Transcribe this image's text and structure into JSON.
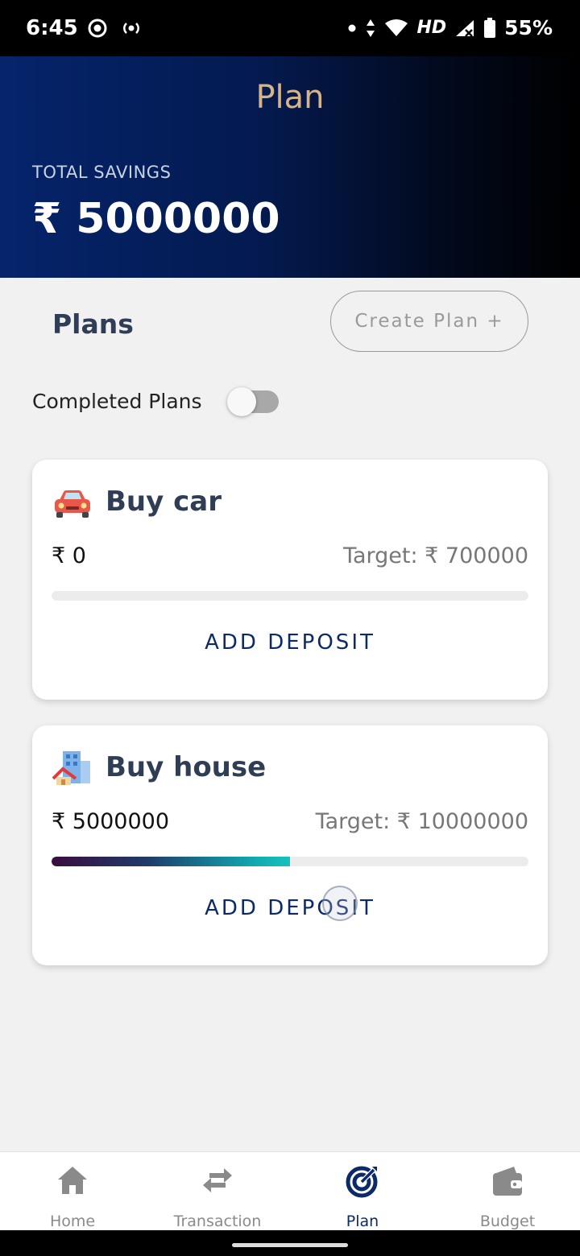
{
  "status_bar": {
    "time": "6:45",
    "network": "HD",
    "battery": "55%"
  },
  "header": {
    "title": "Plan",
    "savings_label": "TOTAL SAVINGS",
    "savings_amount": "₹ 5000000"
  },
  "plans_section": {
    "title": "Plans",
    "create_button": "Create Plan +",
    "completed_label": "Completed Plans",
    "completed_toggle_on": false
  },
  "plans": [
    {
      "icon": "car-icon",
      "title": "Buy car",
      "saved": "₹ 0",
      "target": "Target: ₹ 700000",
      "progress": 0,
      "action": "ADD DEPOSIT"
    },
    {
      "icon": "house-icon",
      "title": "Buy house",
      "saved": "₹ 5000000",
      "target": "Target: ₹ 10000000",
      "progress": 0.5,
      "action": "ADD DEPOSIT"
    }
  ],
  "bottom_nav": [
    {
      "label": "Home",
      "icon": "home-icon",
      "active": false
    },
    {
      "label": "Transaction",
      "icon": "transfer-icon",
      "active": false
    },
    {
      "label": "Plan",
      "icon": "target-icon",
      "active": true
    },
    {
      "label": "Budget",
      "icon": "wallet-icon",
      "active": false
    }
  ],
  "colors": {
    "header_gradient_start": "#05246b",
    "header_title": "#d5b48a",
    "accent": "#0c2a68",
    "progress_gradient": [
      "#3a0d3e",
      "#11a9b0"
    ]
  }
}
